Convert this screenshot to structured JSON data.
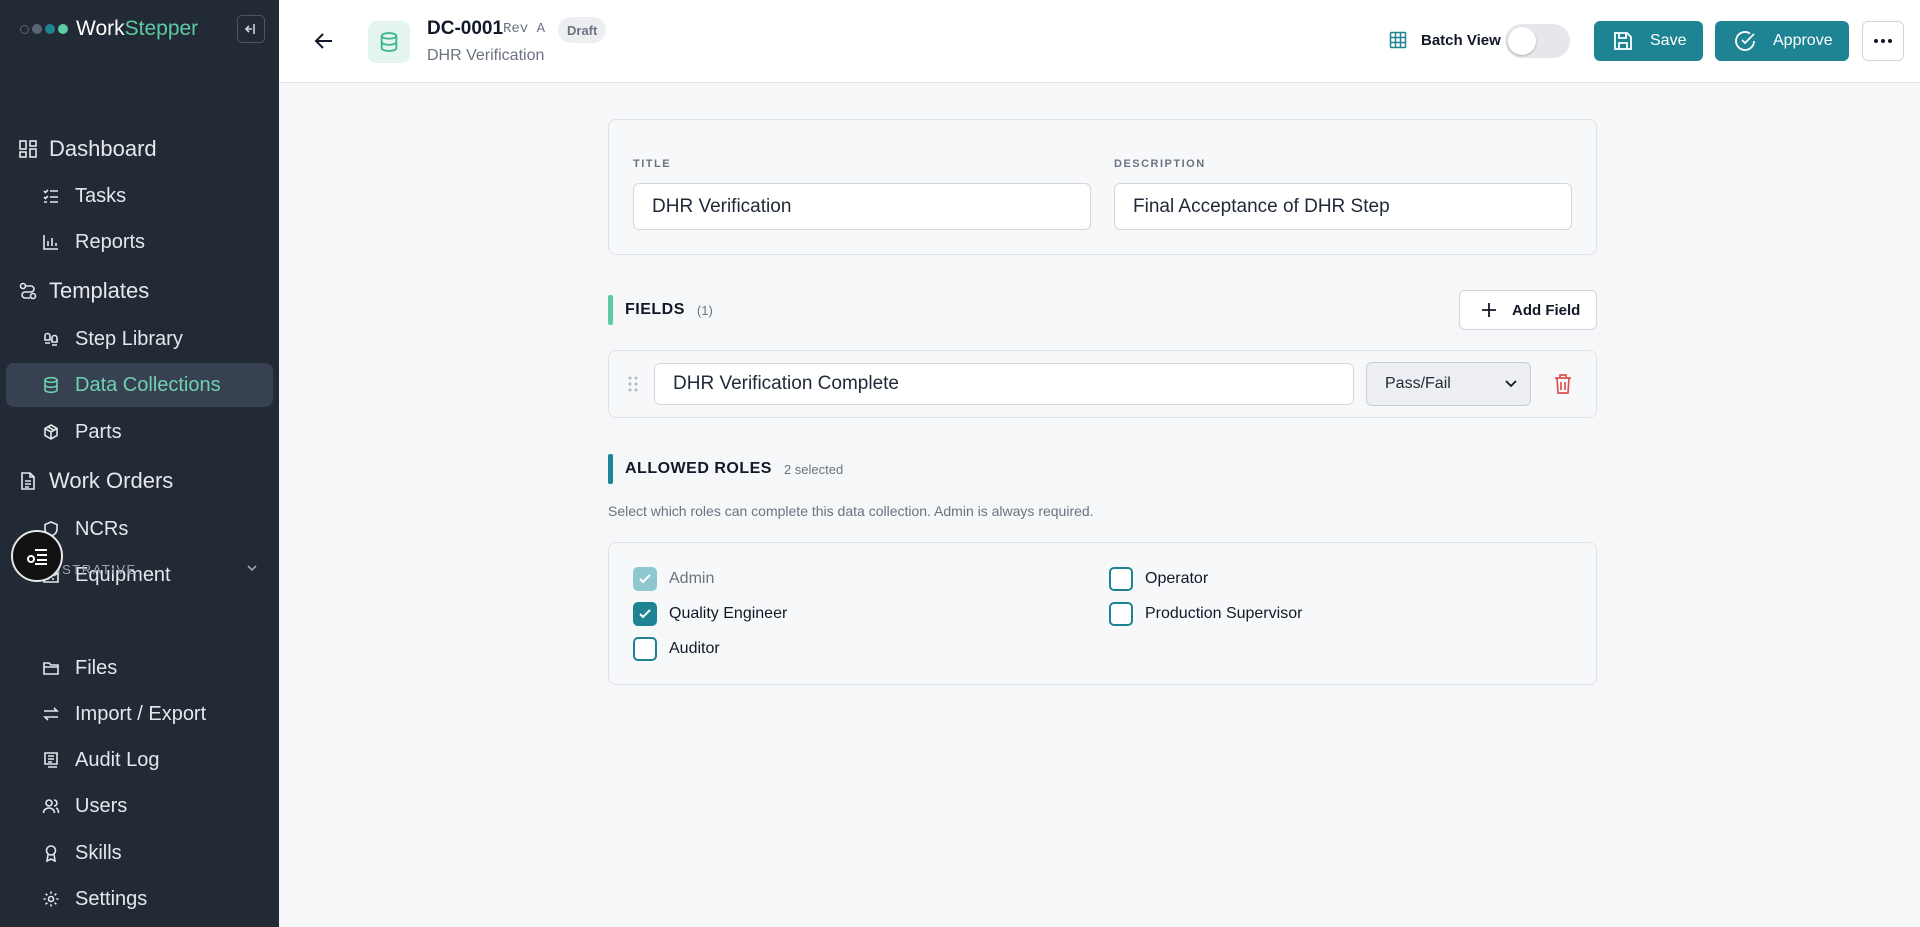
{
  "brand": {
    "name_part1": "Work",
    "name_part2": "Stepper"
  },
  "sidebar": {
    "items": [
      {
        "label": "Dashboard"
      },
      {
        "label": "Tasks"
      },
      {
        "label": "Reports"
      },
      {
        "label": "Templates"
      },
      {
        "label": "Step Library"
      },
      {
        "label": "Data Collections"
      },
      {
        "label": "Parts"
      },
      {
        "label": "Work Orders"
      },
      {
        "label": "NCRs"
      },
      {
        "label": "Equipment"
      },
      {
        "label": "Files"
      },
      {
        "label": "Import / Export"
      },
      {
        "label": "Audit Log"
      },
      {
        "label": "Users"
      },
      {
        "label": "Skills"
      },
      {
        "label": "Settings"
      }
    ],
    "section_label": "ISTRATIVE"
  },
  "header": {
    "doc_id": "DC-0001",
    "revision": "Rev A",
    "status": "Draft",
    "subtitle": "DHR Verification",
    "batch_view_label": "Batch View",
    "batch_view_on": false,
    "save_label": "Save",
    "approve_label": "Approve"
  },
  "form": {
    "title_label": "TITLE",
    "title_value": "DHR Verification",
    "description_label": "DESCRIPTION",
    "description_value": "Final Acceptance of DHR Step"
  },
  "fields_section": {
    "title": "FIELDS",
    "count": "(1)",
    "add_label": "Add Field",
    "fields": [
      {
        "name": "DHR Verification Complete",
        "type": "Pass/Fail"
      }
    ]
  },
  "roles_section": {
    "title": "ALLOWED ROLES",
    "count": "2 selected",
    "helper": "Select which roles can complete this data collection. Admin is always required.",
    "roles": [
      {
        "label": "Admin",
        "checked": true,
        "disabled": true
      },
      {
        "label": "Operator",
        "checked": false
      },
      {
        "label": "Quality Engineer",
        "checked": true
      },
      {
        "label": "Production Supervisor",
        "checked": false
      },
      {
        "label": "Auditor",
        "checked": false
      }
    ]
  },
  "colors": {
    "accent": "#1e8494",
    "sidebar_bg": "#222a36",
    "active_text": "#6fd1b2",
    "fields_bar": "#5fcaa3",
    "delete": "#e05252"
  }
}
